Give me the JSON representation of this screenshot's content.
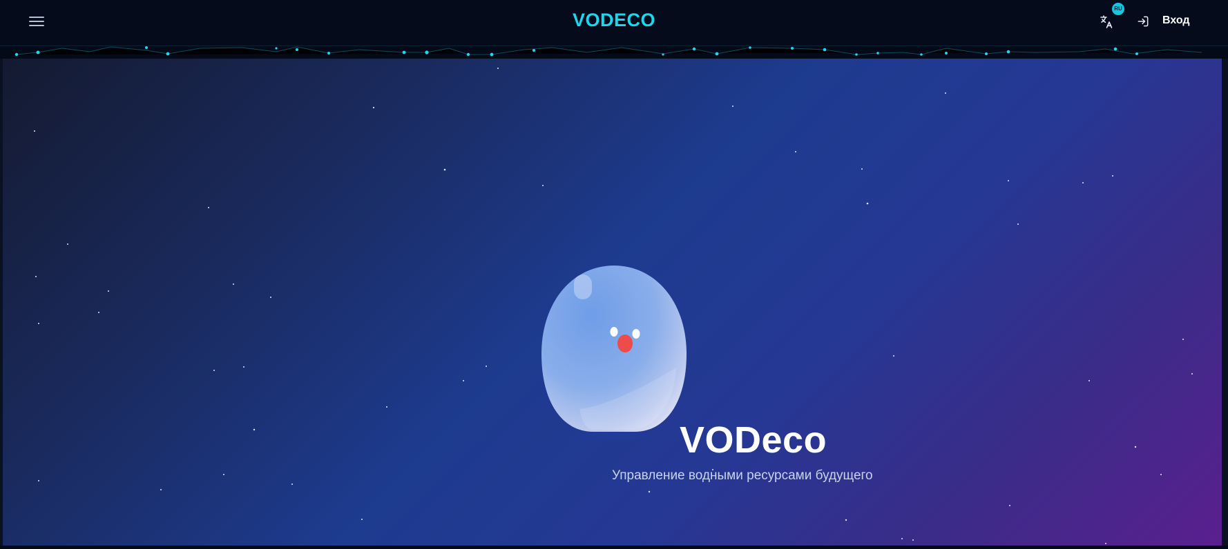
{
  "header": {
    "brand": "VODECO",
    "language_badge": "RU",
    "login_label": "Вход"
  },
  "hero": {
    "title": "VODeco",
    "subtitle": "Управление водными ресурсами будущего"
  },
  "icons": {
    "menu": "hamburger-menu-icon",
    "language": "translate-icon",
    "login": "sign-in-icon",
    "mascot": "water-drop-mascot"
  },
  "colors": {
    "accent": "#1ad8ee",
    "topbar_bg": "#050b1a",
    "hero_gradient_start": "#141a30",
    "hero_gradient_mid": "#1d3b8f",
    "hero_gradient_end": "#5a1f8e"
  }
}
